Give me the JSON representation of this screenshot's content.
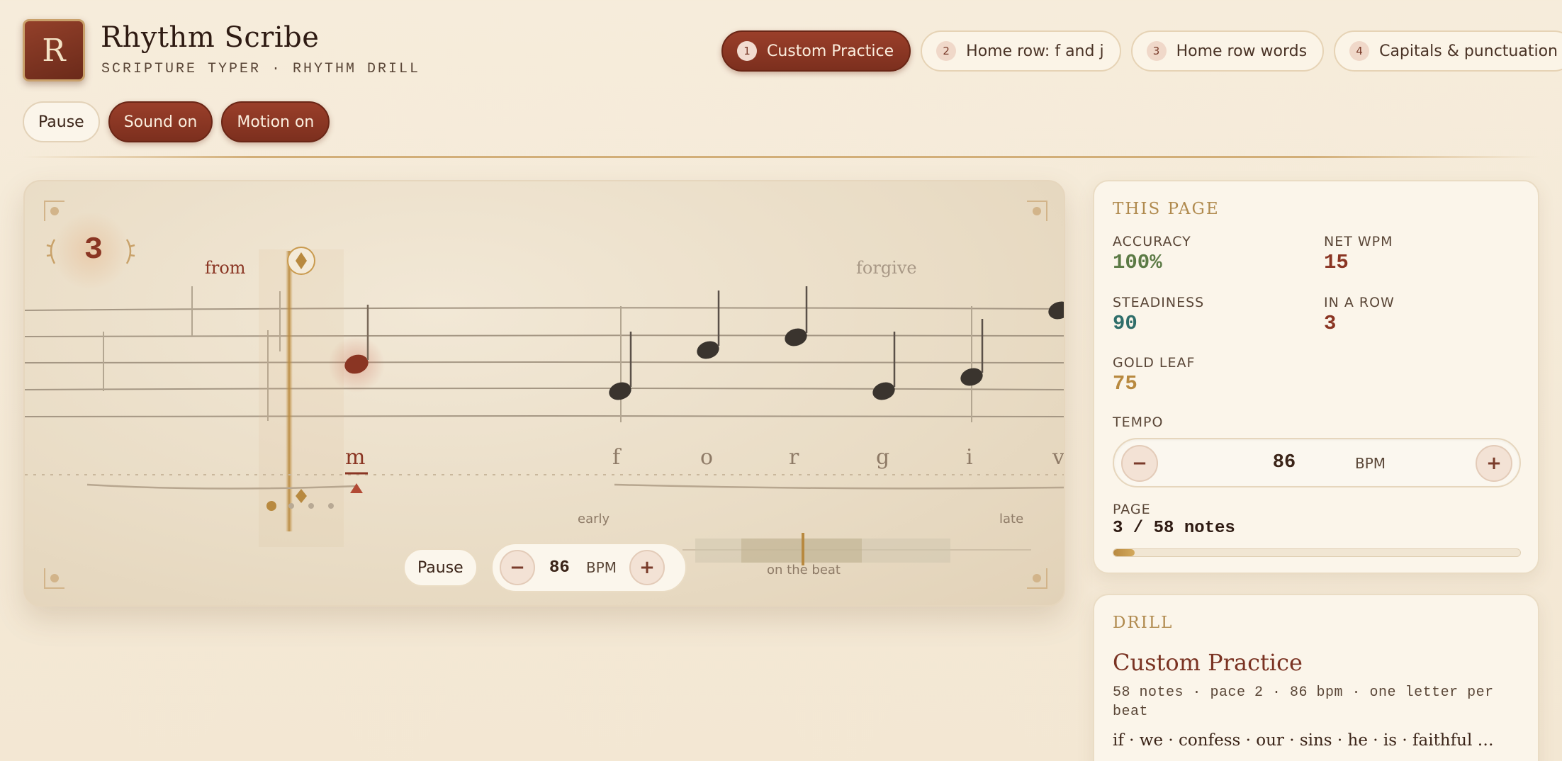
{
  "app": {
    "logo_letter": "R",
    "title": "Rhythm Scribe",
    "subtitle": "SCRIPTURE TYPER · RHYTHM DRILL"
  },
  "drills": [
    {
      "num": "1",
      "label": "Custom Practice",
      "active": true
    },
    {
      "num": "2",
      "label": "Home row: f and j",
      "active": false
    },
    {
      "num": "3",
      "label": "Home row words",
      "active": false
    },
    {
      "num": "4",
      "label": "Capitals & punctuation",
      "active": false
    }
  ],
  "controls": {
    "pause_label": "Pause",
    "sound_label": "Sound on",
    "motion_label": "Motion on"
  },
  "stage": {
    "streak": "3",
    "words": {
      "previous": "from",
      "next": "forgive"
    },
    "letters": [
      "m",
      "f",
      "o",
      "r",
      "g",
      "i",
      "v"
    ],
    "current_letter_index": 0,
    "timing": {
      "early": "early",
      "late": "late",
      "on_beat": "on the beat"
    },
    "pause_label": "Pause",
    "tempo": {
      "value": "86",
      "unit": "BPM",
      "minus": "−",
      "plus": "+"
    },
    "beat_dots": {
      "total": 4,
      "current": 1
    }
  },
  "stats": {
    "heading": "THIS PAGE",
    "accuracy": {
      "label": "ACCURACY",
      "value": "100%"
    },
    "net_wpm": {
      "label": "NET WPM",
      "value": "15"
    },
    "steadiness": {
      "label": "STEADINESS",
      "value": "90"
    },
    "in_a_row": {
      "label": "IN A ROW",
      "value": "3"
    },
    "gold_leaf": {
      "label": "GOLD LEAF",
      "value": "75"
    },
    "tempo": {
      "label": "TEMPO",
      "value": "86",
      "unit": "BPM",
      "minus": "−",
      "plus": "+"
    },
    "page": {
      "label": "PAGE",
      "value": "3 / 58 notes",
      "progress": 0.052
    }
  },
  "drill": {
    "heading": "DRILL",
    "title": "Custom Practice",
    "meta": "58 notes · pace 2 · 86 bpm · one letter per beat",
    "preview": "if · we · confess · our · sins · he · is · faithful …"
  },
  "colors": {
    "accent": "#8a3523",
    "gold": "#b8893f",
    "accuracy": "#5b7a45",
    "steadiness": "#2f6e6a",
    "paper": "#f6ecdb"
  }
}
